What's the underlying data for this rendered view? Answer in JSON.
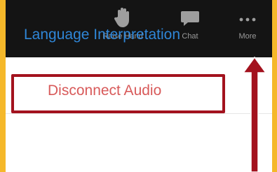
{
  "toolbar": {
    "raise_hand": {
      "label": "Raise Hand",
      "icon": "raised-hand-icon"
    },
    "chat": {
      "label": "Chat",
      "icon": "chat-bubble-icon"
    },
    "more": {
      "label": "More",
      "icon": "more-dots-icon"
    }
  },
  "menu": {
    "items": [
      {
        "label": "Language Interpretation",
        "color": "#2f86d7"
      },
      {
        "label": "Disconnect Audio",
        "color": "#d85a5a"
      }
    ]
  },
  "annotation": {
    "highlight_color": "#a3121e",
    "arrow_color": "#a3121e"
  },
  "colors": {
    "background": "#f5b82a",
    "toolbar": "#141414"
  }
}
